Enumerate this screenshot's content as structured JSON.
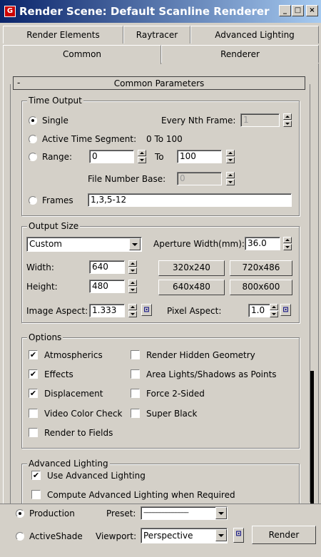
{
  "window": {
    "title": "Render Scene: Default Scanline Renderer",
    "minimize": "_",
    "restore": "□",
    "close": "×",
    "icon": "3ds-max-render-icon"
  },
  "tabs": {
    "row1": [
      "Render Elements",
      "Raytracer",
      "Advanced Lighting"
    ],
    "row2": [
      "Common",
      "Renderer"
    ],
    "active": "Common"
  },
  "rollout": {
    "toggle": "-",
    "title": "Common Parameters"
  },
  "time_output": {
    "legend": "Time Output",
    "single": "Single",
    "every_nth_label": "Every Nth Frame:",
    "every_nth_value": "1",
    "active_segment": "Active Time Segment:",
    "active_segment_value": "0 To 100",
    "range": "Range:",
    "range_from": "0",
    "range_to_label": "To",
    "range_to": "100",
    "file_number_base_label": "File Number Base:",
    "file_number_base_value": "0",
    "frames": "Frames",
    "frames_value": "1,3,5-12",
    "selected": "single"
  },
  "output_size": {
    "legend": "Output Size",
    "preset": "Custom",
    "aperture_label": "Aperture Width(mm):",
    "aperture_value": "36.0",
    "width_label": "Width:",
    "width_value": "640",
    "height_label": "Height:",
    "height_value": "480",
    "presets": [
      "320x240",
      "720x486",
      "640x480",
      "800x600"
    ],
    "image_aspect_label": "Image Aspect:",
    "image_aspect_value": "1.333",
    "pixel_aspect_label": "Pixel Aspect:",
    "pixel_aspect_value": "1.0"
  },
  "options": {
    "legend": "Options",
    "items": [
      {
        "label": "Atmospherics",
        "checked": true
      },
      {
        "label": "Render Hidden Geometry",
        "checked": false
      },
      {
        "label": "Effects",
        "checked": true
      },
      {
        "label": "Area Lights/Shadows as Points",
        "checked": false
      },
      {
        "label": "Displacement",
        "checked": true
      },
      {
        "label": "Force 2-Sided",
        "checked": false
      },
      {
        "label": "Video Color Check",
        "checked": false
      },
      {
        "label": "Super Black",
        "checked": false
      },
      {
        "label": "Render to Fields",
        "checked": false
      }
    ]
  },
  "advanced_lighting": {
    "legend": "Advanced Lighting",
    "use": "Use Advanced Lighting",
    "use_checked": true,
    "compute": "Compute Advanced Lighting when Required",
    "compute_checked": false
  },
  "bottom": {
    "production": "Production",
    "activeshade": "ActiveShade",
    "selected": "production",
    "preset_label": "Preset:",
    "preset_value": "----------------------------",
    "viewport_label": "Viewport:",
    "viewport_value": "Perspective",
    "render_label": "Render"
  },
  "icons": {
    "check": "✔",
    "lock": "🔒"
  }
}
